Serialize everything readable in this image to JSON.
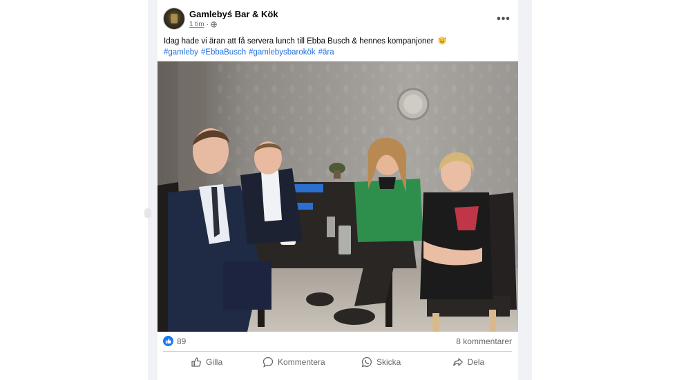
{
  "post": {
    "page_name": "Gamlebyś Bar & Kök",
    "time": "1 tim",
    "separator": "·",
    "caption": "Idag hade vi äran att få servera lunch till Ebba Busch & hennes kompanjoner",
    "caption_emoji": "smiling-face-with-hearts-icon",
    "hashtags": [
      "#gamleby",
      "#EbbaBusch",
      "#gamlebysbarokök",
      "#ära"
    ],
    "photo_description_icon": "group-photo-at-restaurant-table"
  },
  "stats": {
    "likes": "89",
    "comments": "8 kommentarer"
  },
  "actions": [
    {
      "label": "Gilla",
      "icon": "thumbs-up-icon"
    },
    {
      "label": "Kommentera",
      "icon": "comment-icon"
    },
    {
      "label": "Skicka",
      "icon": "whatsapp-icon"
    },
    {
      "label": "Dela",
      "icon": "share-icon"
    }
  ],
  "colors": {
    "hashtag": "#216fdb",
    "like_badge": "#1877f2",
    "secondary_text": "#65676b",
    "page_bg": "#f0f2f5"
  }
}
